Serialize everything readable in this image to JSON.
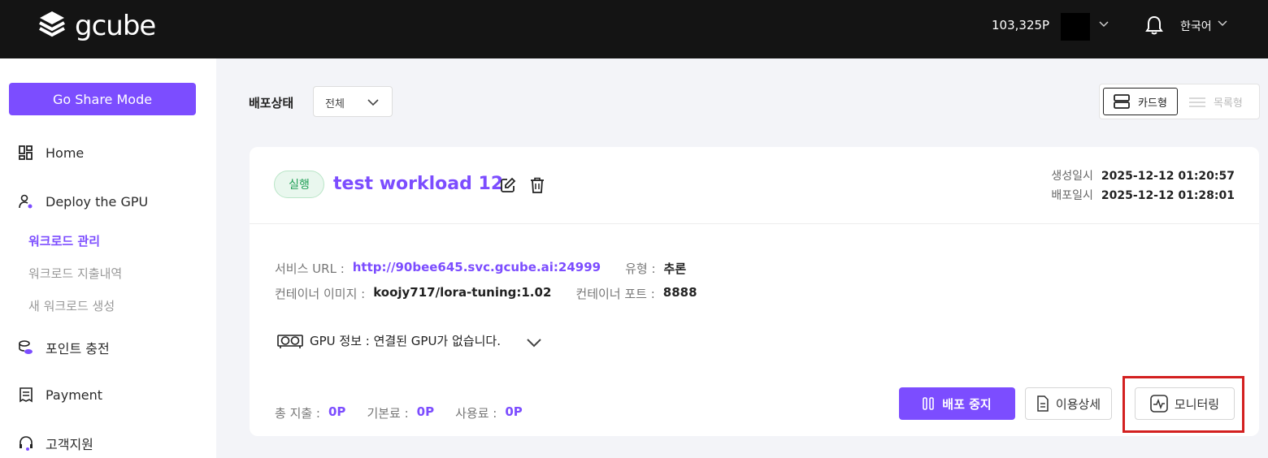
{
  "header": {
    "logo_text": "gcube",
    "points": "103,325P",
    "language": "한국어"
  },
  "sidebar": {
    "share_button": "Go Share Mode",
    "items": [
      {
        "label": "Home",
        "icon": "grid-icon"
      },
      {
        "label": "Deploy the GPU",
        "icon": "user-gear-icon"
      },
      {
        "label": "포인트 충전",
        "icon": "coins-icon"
      },
      {
        "label": "Payment",
        "icon": "receipt-icon"
      },
      {
        "label": "고객지원",
        "icon": "headset-icon"
      }
    ],
    "subitems": [
      {
        "label": "워크로드 관리",
        "active": true
      },
      {
        "label": "워크로드 지출내역",
        "active": false
      },
      {
        "label": "새 워크로드 생성",
        "active": false
      }
    ]
  },
  "filter": {
    "label": "배포상태",
    "selected": "전체"
  },
  "view_toggle": {
    "card": "카드형",
    "list": "목록형"
  },
  "workload": {
    "status": "실행",
    "title": "test workload 12",
    "created_label": "생성일시",
    "created_value": "2025-12-12 01:20:57",
    "deployed_label": "배포일시",
    "deployed_value": "2025-12-12 01:28:01",
    "service_url_label": "서비스 URL :",
    "service_url": "http://90bee645.svc.gcube.ai:24999",
    "type_label": "유형 :",
    "type_value": "추론",
    "image_label": "컨테이너 이미지 :",
    "image_value": "koojy717/lora-tuning:1.02",
    "port_label": "컨테이너 포트 :",
    "port_value": "8888",
    "gpu_info": "GPU 정보 : 연결된 GPU가 없습니다.",
    "total_label": "총 지출 :",
    "total_value": "0P",
    "base_label": "기본료 :",
    "base_value": "0P",
    "usage_label": "사용료 :",
    "usage_value": "0P",
    "stop_button": "배포 중지",
    "detail_button": "이용상세",
    "monitor_button": "모니터링"
  },
  "colors": {
    "accent": "#7c4dff",
    "topbar": "#141414",
    "status_green": "#1f9f55",
    "highlight": "#d32020"
  }
}
